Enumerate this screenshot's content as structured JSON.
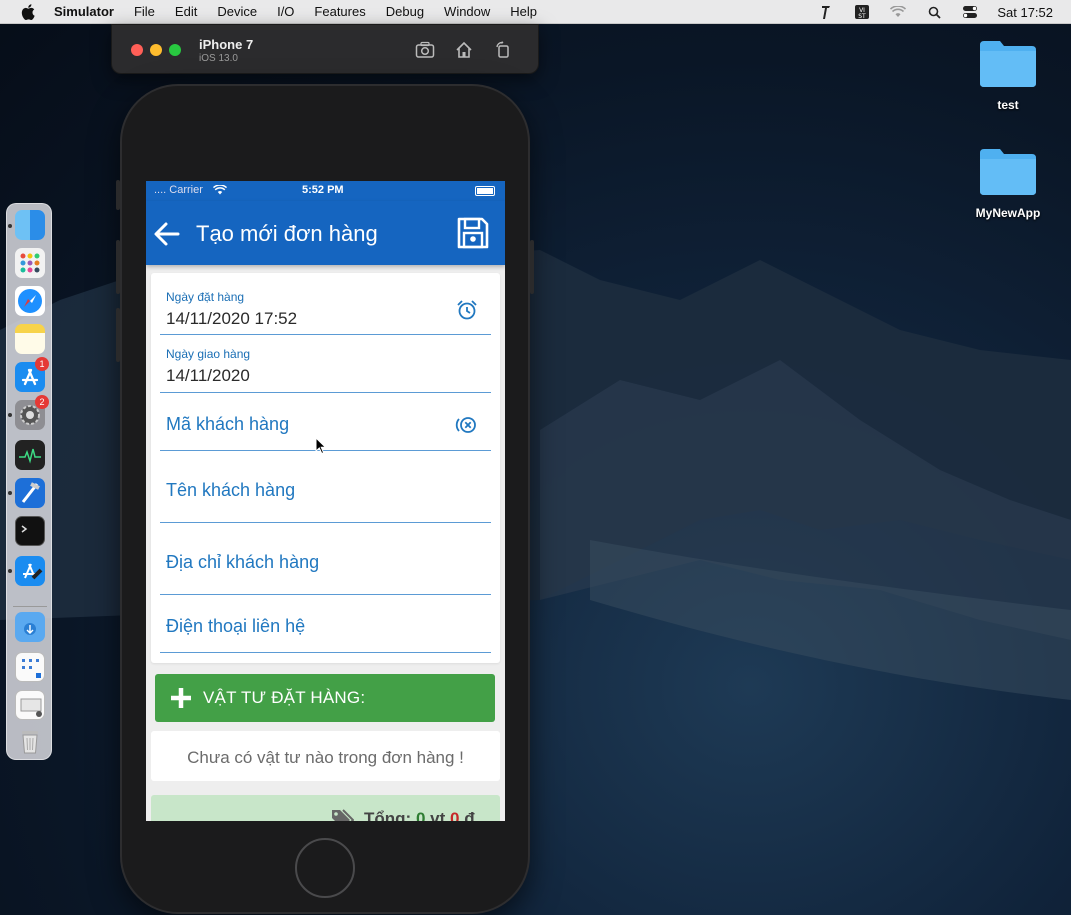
{
  "menubar": {
    "app": "Simulator",
    "items": [
      "File",
      "Edit",
      "Device",
      "I/O",
      "Features",
      "Debug",
      "Window",
      "Help"
    ],
    "clock": "Sat 17:52"
  },
  "simulator": {
    "device_name": "iPhone 7",
    "os_version": "iOS 13.0"
  },
  "statusbar": {
    "carrier": ".... Carrier",
    "time": "5:52 PM"
  },
  "appbar": {
    "title": "Tạo mới đơn hàng"
  },
  "form": {
    "order_date_label": "Ngày đặt hàng",
    "order_date_value": "14/11/2020 17:52",
    "delivery_date_label": "Ngày giao hàng",
    "delivery_date_value": "14/11/2020",
    "customer_code_placeholder": "Mã khách hàng",
    "customer_name_placeholder": "Tên khách hàng",
    "customer_address_placeholder": "Địa chỉ khách hàng",
    "contact_phone_placeholder": "Điện thoại liên hệ"
  },
  "materials": {
    "add_label": "VẬT TƯ ĐẶT HÀNG:",
    "empty_message": "Chưa có vật tư nào trong đơn hàng !"
  },
  "total": {
    "label": "Tổng:",
    "item_count": "0",
    "item_unit": "vt",
    "amount": "0",
    "currency": "đ"
  },
  "desktop": {
    "folders": [
      "test",
      "MyNewApp"
    ]
  },
  "dock": {
    "badges": [
      "1",
      "2"
    ]
  },
  "colors": {
    "primary": "#1565c0",
    "success": "#43a047",
    "total_bg": "#c8e6c9",
    "field_text": "#2178c0"
  }
}
